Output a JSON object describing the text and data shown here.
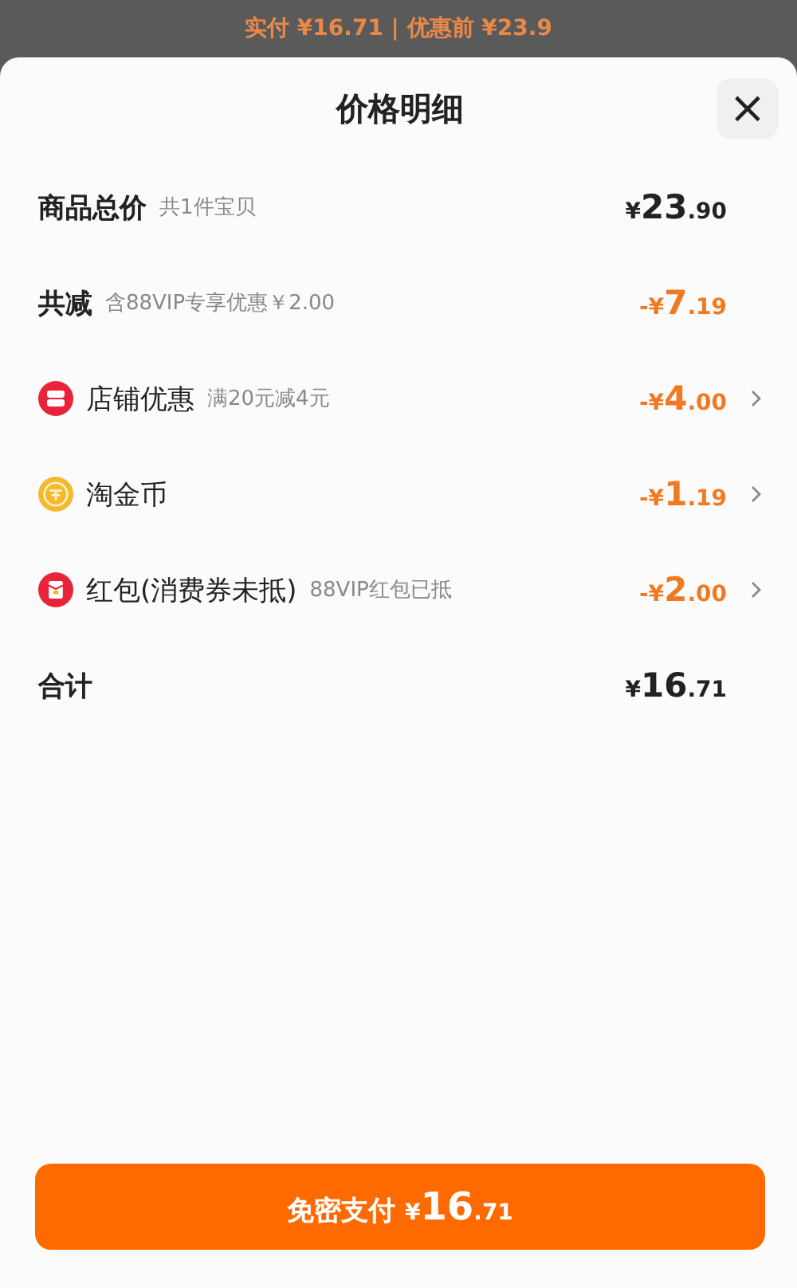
{
  "backdrop": {
    "text": "实付 ¥16.71 | 优惠前 ¥23.9"
  },
  "sheet": {
    "title": "价格明细",
    "close": "×"
  },
  "rows": [
    {
      "kind": "header",
      "label": "商品总价",
      "note": "共1件宝贝",
      "amount": {
        "lead": "¥",
        "main": "23",
        "cents": ".90"
      },
      "discount": false,
      "has_arrow": false
    },
    {
      "kind": "header",
      "label": "共减",
      "note": "含88VIP专享优惠￥2.00",
      "amount": {
        "lead": "-¥",
        "main": "7",
        "cents": ".19"
      },
      "discount": true,
      "has_arrow": false
    },
    {
      "kind": "shop",
      "label": "店铺优惠",
      "note": "满20元减4元",
      "amount": {
        "lead": "-¥",
        "main": "4",
        "cents": ".00"
      },
      "discount": true,
      "has_arrow": true
    },
    {
      "kind": "coin",
      "label": "淘金币",
      "amount": {
        "lead": "-¥",
        "main": "1",
        "cents": ".19"
      },
      "discount": true,
      "has_arrow": true
    },
    {
      "kind": "envelope",
      "label": "红包(消费券未抵)",
      "note": "88VIP红包已抵",
      "amount": {
        "lead": "-¥",
        "main": "2",
        "cents": ".00"
      },
      "discount": true,
      "has_arrow": true
    },
    {
      "kind": "header",
      "label": "合计",
      "amount": {
        "lead": "¥",
        "main": "16",
        "cents": ".71"
      },
      "discount": false,
      "has_arrow": false
    }
  ],
  "pay_button": {
    "label": "免密支付",
    "amount": {
      "lead": "¥",
      "main": "16",
      "cents": ".71"
    }
  }
}
